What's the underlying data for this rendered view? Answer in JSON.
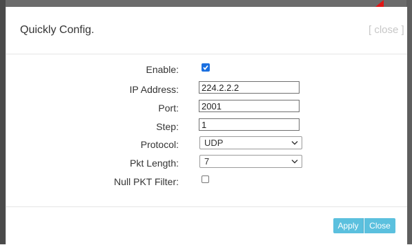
{
  "dialog": {
    "title": "Quickly Config.",
    "close_link": "[ close ]"
  },
  "form": {
    "enable": {
      "label": "Enable:",
      "checked": true
    },
    "ip_address": {
      "label": "IP Address:",
      "value": "224.2.2.2"
    },
    "port": {
      "label": "Port:",
      "value": "2001"
    },
    "step": {
      "label": "Step:",
      "value": "1"
    },
    "protocol": {
      "label": "Protocol:",
      "selected": "UDP"
    },
    "pkt_length": {
      "label": "Pkt Length:",
      "selected": "7"
    },
    "null_pkt_filter": {
      "label": "Null PKT Filter:",
      "checked": false
    }
  },
  "buttons": {
    "apply": "Apply",
    "close": "Close"
  },
  "colors": {
    "button": "#5bc0de",
    "checkbox_checked": "#1a6fe0",
    "close_link": "#c7c7c7"
  }
}
